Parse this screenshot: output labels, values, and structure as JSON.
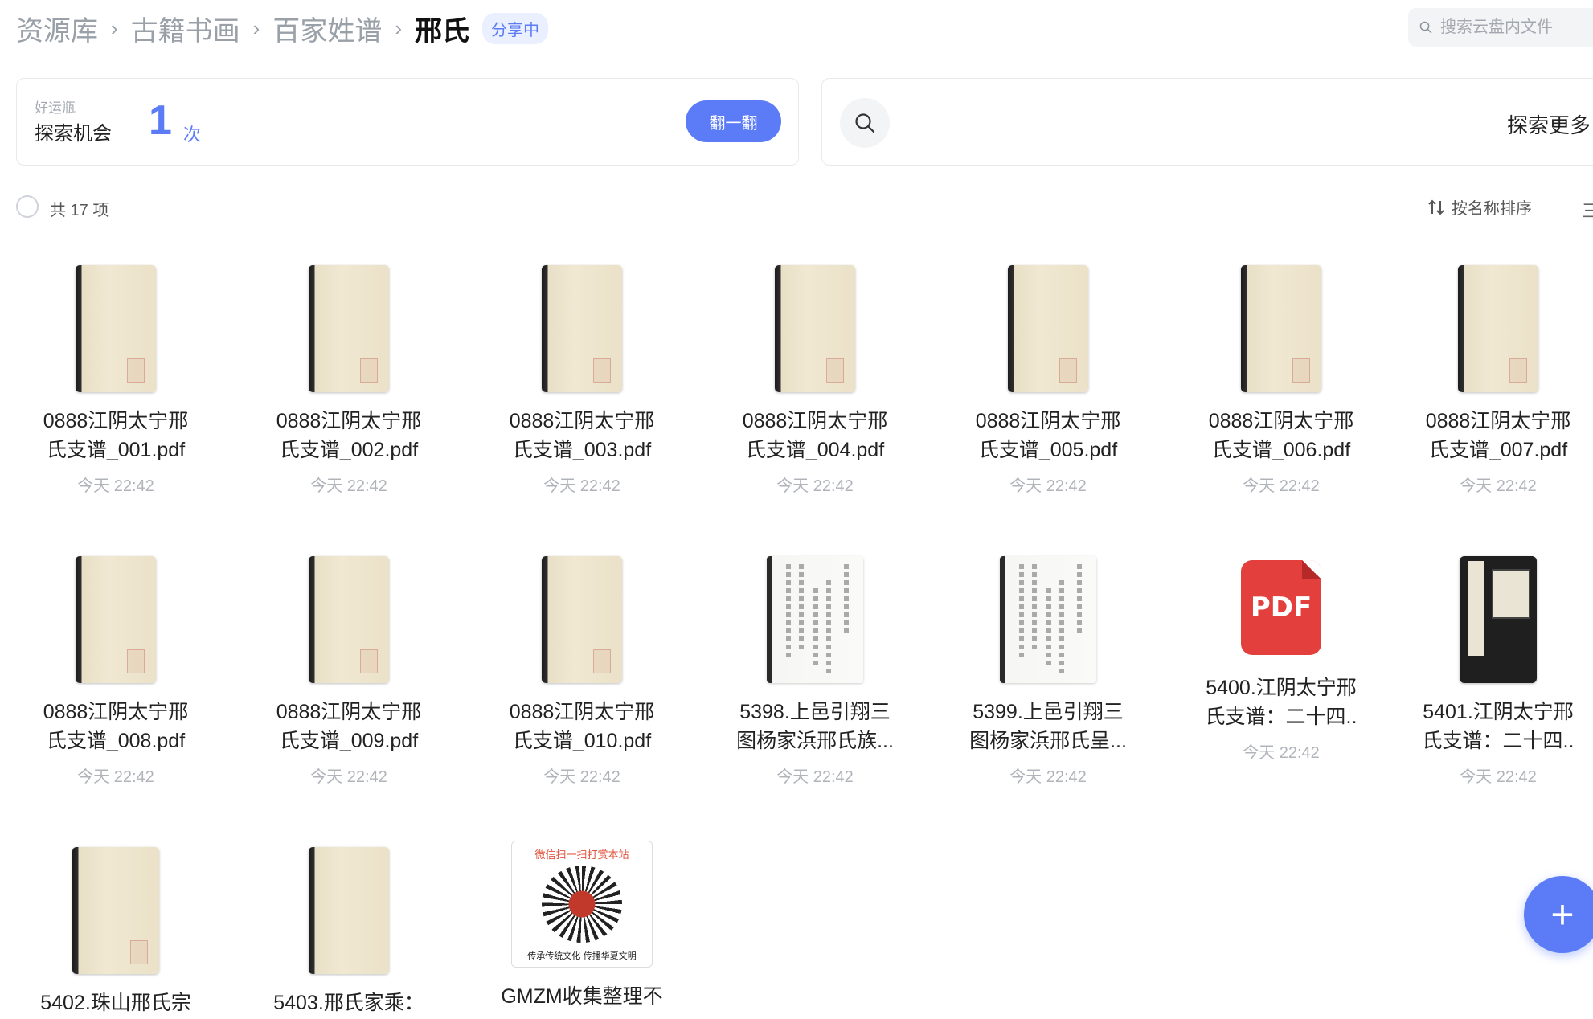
{
  "breadcrumb": {
    "items": [
      "资源库",
      "古籍书画",
      "百家姓谱"
    ],
    "current": "邢氏",
    "share_badge": "分享中"
  },
  "search": {
    "placeholder": "搜索云盘内文件"
  },
  "lucky": {
    "sub_label": "好运瓶",
    "label": "探索机会",
    "count": "1",
    "unit": "次",
    "button": "翻一翻"
  },
  "explore": {
    "label": "探索更多"
  },
  "toolbar": {
    "count_text": "共 17 项",
    "sort_label": "按名称排序",
    "view_icon": "三"
  },
  "files": [
    {
      "name_line1": "0888江阴太宁邢",
      "name_line2": "氏支谱_001.pdf",
      "date": "今天 22:42",
      "thumb": "book"
    },
    {
      "name_line1": "0888江阴太宁邢",
      "name_line2": "氏支谱_002.pdf",
      "date": "今天 22:42",
      "thumb": "book"
    },
    {
      "name_line1": "0888江阴太宁邢",
      "name_line2": "氏支谱_003.pdf",
      "date": "今天 22:42",
      "thumb": "book"
    },
    {
      "name_line1": "0888江阴太宁邢",
      "name_line2": "氏支谱_004.pdf",
      "date": "今天 22:42",
      "thumb": "book"
    },
    {
      "name_line1": "0888江阴太宁邢",
      "name_line2": "氏支谱_005.pdf",
      "date": "今天 22:42",
      "thumb": "book"
    },
    {
      "name_line1": "0888江阴太宁邢",
      "name_line2": "氏支谱_006.pdf",
      "date": "今天 22:42",
      "thumb": "book"
    },
    {
      "name_line1": "0888江阴太宁邢",
      "name_line2": "氏支谱_007.pdf",
      "date": "今天 22:42",
      "thumb": "book"
    },
    {
      "name_line1": "0888江阴太宁邢",
      "name_line2": "氏支谱_008.pdf",
      "date": "今天 22:42",
      "thumb": "book"
    },
    {
      "name_line1": "0888江阴太宁邢",
      "name_line2": "氏支谱_009.pdf",
      "date": "今天 22:42",
      "thumb": "book"
    },
    {
      "name_line1": "0888江阴太宁邢",
      "name_line2": "氏支谱_010.pdf",
      "date": "今天 22:42",
      "thumb": "book"
    },
    {
      "name_line1": "5398.上邑引翔三",
      "name_line2": "图杨家浜邢氏族...",
      "date": "今天 22:42",
      "thumb": "page"
    },
    {
      "name_line1": "5399.上邑引翔三",
      "name_line2": "图杨家浜邢氏呈...",
      "date": "今天 22:42",
      "thumb": "page"
    },
    {
      "name_line1": "5400.江阴太宁邢",
      "name_line2": "氏支谱：二十四..",
      "date": "今天 22:42",
      "thumb": "pdf",
      "pdf_text": "PDF"
    },
    {
      "name_line1": "5401.江阴太宁邢",
      "name_line2": "氏支谱：二十四..",
      "date": "今天 22:42",
      "thumb": "cover"
    },
    {
      "name_line1": "5402.珠山邢氏宗",
      "name_line2": "",
      "date": "",
      "thumb": "book"
    },
    {
      "name_line1": "5403.邢氏家乘：",
      "name_line2": "",
      "date": "",
      "thumb": "book"
    },
    {
      "name_line1": "GMZM收集整理不",
      "name_line2": "",
      "date": "",
      "thumb": "qr",
      "qr_title": "微信扫一扫打赏本站",
      "qr_foot": "传承传统文化 传播华夏文明"
    }
  ],
  "fab": {
    "icon": "plus-icon",
    "label": "+"
  }
}
